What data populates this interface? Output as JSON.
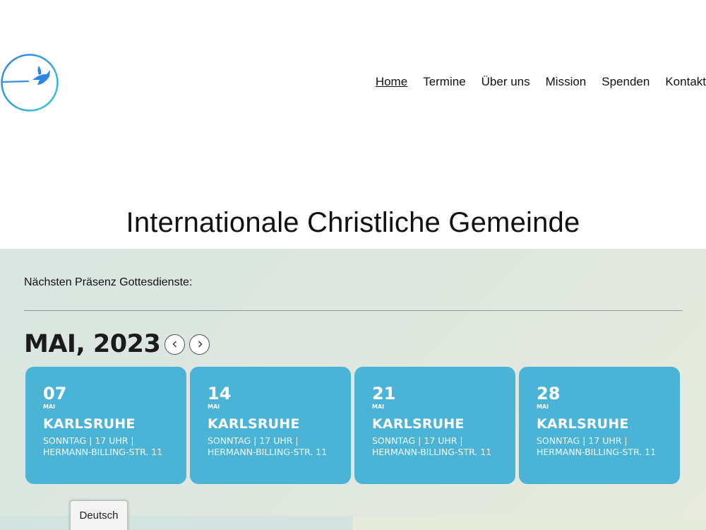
{
  "nav": {
    "items": [
      {
        "label": "Home",
        "active": true
      },
      {
        "label": "Termine"
      },
      {
        "label": "Über uns"
      },
      {
        "label": "Mission"
      },
      {
        "label": "Spenden"
      },
      {
        "label": "Kontakt"
      }
    ]
  },
  "site": {
    "title": "Internationale Christliche Gemeinde"
  },
  "events": {
    "intro": "Nächsten Präsenz Gottesdienste:",
    "month_title": "MAI, 2023",
    "prev_icon": "chevron-left-icon",
    "next_icon": "chevron-right-icon",
    "cards": [
      {
        "day": "07",
        "month": "MAI",
        "city": "KARLSRUHE",
        "line1": "SONNTAG | 17 UHR |",
        "line2": "HERMANN-BILLING-STR. 11"
      },
      {
        "day": "14",
        "month": "MAI",
        "city": "KARLSRUHE",
        "line1": "SONNTAG | 17 UHR |",
        "line2": "HERMANN-BILLING-STR. 11"
      },
      {
        "day": "21",
        "month": "MAI",
        "city": "KARLSRUHE",
        "line1": "SONNTAG | 17 UHR |",
        "line2": "HERMANN-BILLING-STR. 11"
      },
      {
        "day": "28",
        "month": "MAI",
        "city": "KARLSRUHE",
        "line1": "SONNTAG | 17 UHR |",
        "line2": "HERMANN-BILLING-STR. 11"
      }
    ]
  },
  "language": {
    "label": "Deutsch"
  },
  "colors": {
    "card": "#4ab3d6",
    "logo_blue": "#2a8fe0",
    "logo_teal": "#31b8d8"
  }
}
